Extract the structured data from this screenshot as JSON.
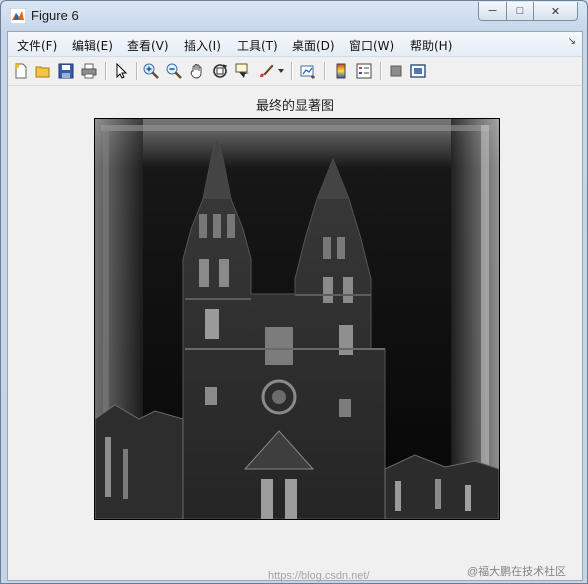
{
  "window": {
    "title": "Figure 6",
    "minimize_glyph": "─",
    "maximize_glyph": "□",
    "close_glyph": "✕"
  },
  "menubar": {
    "items": [
      {
        "label": "文件(F)"
      },
      {
        "label": "编辑(E)"
      },
      {
        "label": "查看(V)"
      },
      {
        "label": "插入(I)"
      },
      {
        "label": "工具(T)"
      },
      {
        "label": "桌面(D)"
      },
      {
        "label": "窗口(W)"
      },
      {
        "label": "帮助(H)"
      }
    ],
    "overflow_glyph": "↘"
  },
  "toolbar": {
    "icons": [
      "new-figure-icon",
      "open-file-icon",
      "save-icon",
      "print-icon",
      "edit-plot-icon",
      "zoom-in-icon",
      "zoom-out-icon",
      "pan-hand-icon",
      "rotate-3d-icon",
      "data-cursor-icon",
      "brush-icon",
      "brush-dropdown-icon",
      "link-plot-icon",
      "colorbar-icon",
      "legend-icon",
      "hide-plot-tools-icon",
      "show-plot-tools-icon"
    ]
  },
  "figure": {
    "title": "最终的显著图"
  },
  "watermark": {
    "text": "https://blog.csdn.net/",
    "text2": "@福大鹏在技术社区"
  },
  "colors": {
    "accent": "#2c5fa8",
    "image_dark": "#050505"
  }
}
